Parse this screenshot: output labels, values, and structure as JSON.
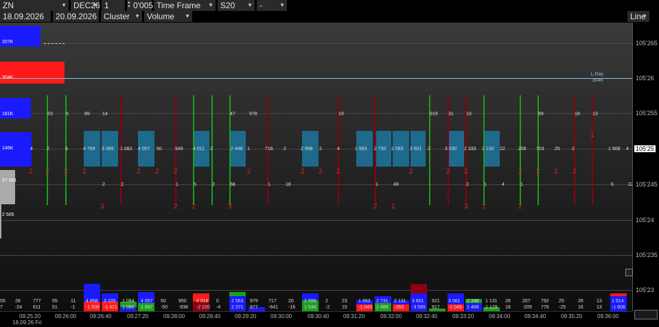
{
  "toolbar": {
    "symbol": "ZN",
    "contract": "DEC26",
    "multiplier": "1",
    "tick": "0'005",
    "period_type": "Time Frame",
    "period": "S20",
    "extra": "-",
    "date_from": "18.09.2026",
    "date_to": "20.09.2026",
    "chart_mode": "Cluster",
    "cluster_value": "Volume",
    "style": "Line"
  },
  "price_axis": [
    "105'265",
    "105'26",
    "105'255",
    "105'25",
    "105'245",
    "105'24",
    "105'235",
    "105'23"
  ],
  "current_price": "105'25",
  "level_label": "L.Day",
  "level_value": "304K",
  "volume_profile": [
    "207K",
    "304K",
    "181K",
    "146K",
    "67 581",
    "2 505"
  ],
  "time_axis": [
    "09:25:20",
    "09:26:00",
    "09:26:40",
    "09:27:20",
    "09:28:00",
    "09:28:40",
    "09:29:20",
    "09:30:00",
    "09:30:40",
    "09:31:20",
    "09:32:00",
    "09:32:40",
    "09:33:20",
    "09:34:00",
    "09:34:40",
    "09:35:20",
    "09:36:00"
  ],
  "date_label": "18.09.26 Fri",
  "cluster_top": [
    "53",
    "5",
    "89",
    "14",
    "47",
    "978",
    "19",
    "919",
    "31",
    "13",
    "89",
    "18",
    "13"
  ],
  "cluster_mid": [
    "4",
    "2",
    "6",
    "4 769",
    "3 089",
    "1 082",
    "4 057",
    "50",
    "949",
    "4 011",
    "2",
    "2 448",
    "1",
    "716",
    "2",
    "2 998",
    "2",
    "4",
    "1 993",
    "2 730",
    "2 083",
    "3 601",
    "2",
    "3 030",
    "2 333",
    "1 130",
    "22",
    "206",
    "703",
    "25",
    "2",
    "1 908",
    "4"
  ],
  "cluster_low": [
    "2",
    "2",
    "1",
    "5",
    "2",
    "68",
    "1",
    "18",
    "1",
    "48",
    "2",
    "1",
    "4",
    "1",
    "6",
    "22"
  ],
  "delta_top": [
    "05",
    "28",
    "777",
    "55",
    "11",
    "4 858",
    "3 105",
    "1 084",
    "4 057",
    "50",
    "950",
    "4 016",
    "0",
    "2 563",
    "979",
    "717",
    "20",
    "2 998",
    "2",
    "23",
    "1 993",
    "2 731",
    "2 131",
    "3 601",
    "921",
    "3 061",
    "2 348",
    "1 131",
    "26",
    "207",
    "792",
    "25",
    "26",
    "13",
    "1 914"
  ],
  "delta_bot": [
    "7",
    "-24",
    "611",
    "51",
    "-1",
    "-1 508",
    "-1 421",
    "1 080",
    "1 947",
    "-50",
    "-938",
    "-2 220",
    "-4",
    "2 371",
    "977",
    "-641",
    "-16",
    "1 534",
    "-2",
    "15",
    "-1 049",
    "1 489",
    "-263",
    "-3 585",
    "917",
    "-1 049",
    "1 468",
    "1 129",
    "18",
    "-205",
    "776",
    "-25",
    "16",
    "13",
    "-1 606"
  ],
  "colors": {
    "ask": "#1a1aff",
    "bid": "#ff1a1a",
    "up": "#1aa01a",
    "down": "#8a0010",
    "box": "#1e6a8c",
    "level": "#8ec0e0"
  }
}
